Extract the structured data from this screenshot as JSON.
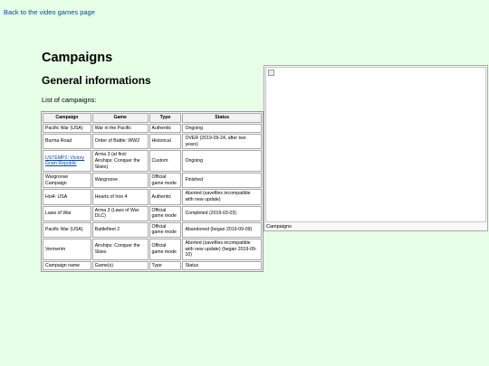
{
  "nav": {
    "back_label": "Back to the video games page"
  },
  "page_title": "Campaigns",
  "section_title": "General informations",
  "intro_text": "List of campaigns:",
  "table": {
    "headers": [
      "Campaign",
      "Game",
      "Type",
      "Status"
    ],
    "rows": [
      [
        "Pacific War (USA)",
        "War in the Pacific",
        "Authentic",
        "Ongoing"
      ],
      [
        "Burma Road",
        "Order of Battle: WW2",
        "Historical",
        "OVER (2019-09-24, after two years)"
      ],
      [
        "USTEMP2: Victory Gram Republic",
        "Arma 3 (at first: Airships: Conquer the Skies)",
        "Custom",
        "Ongoing"
      ],
      [
        "Wargroove Campaign",
        "Wargroove",
        "Official game mode",
        "Finished"
      ],
      [
        "Hoi4: USA",
        "Hearts of Iron 4",
        "Authentic",
        "Aborted (savefiles incompatible with new update)"
      ],
      [
        "Laws of War",
        "Arma 3 (Laws of War DLC)",
        "Official game mode",
        "Completed (2019-03-03)"
      ],
      [
        "Pacific War (USA)",
        "Battlefleet 2",
        "Official game mode",
        "Abandoned (began 2019-09-09)"
      ],
      [
        "Vermerim",
        "Airships: Conquer the Skies",
        "Official game mode",
        "Aborted (savefiles incompatible with new update) (began 2019-09-10)"
      ]
    ],
    "footer": [
      "Campaign name",
      "Game(s)",
      "Type",
      "Status"
    ]
  },
  "figure": {
    "caption": "Campaigns"
  },
  "colors": {
    "background": "#e6ffe6",
    "link": "#0645ad"
  }
}
